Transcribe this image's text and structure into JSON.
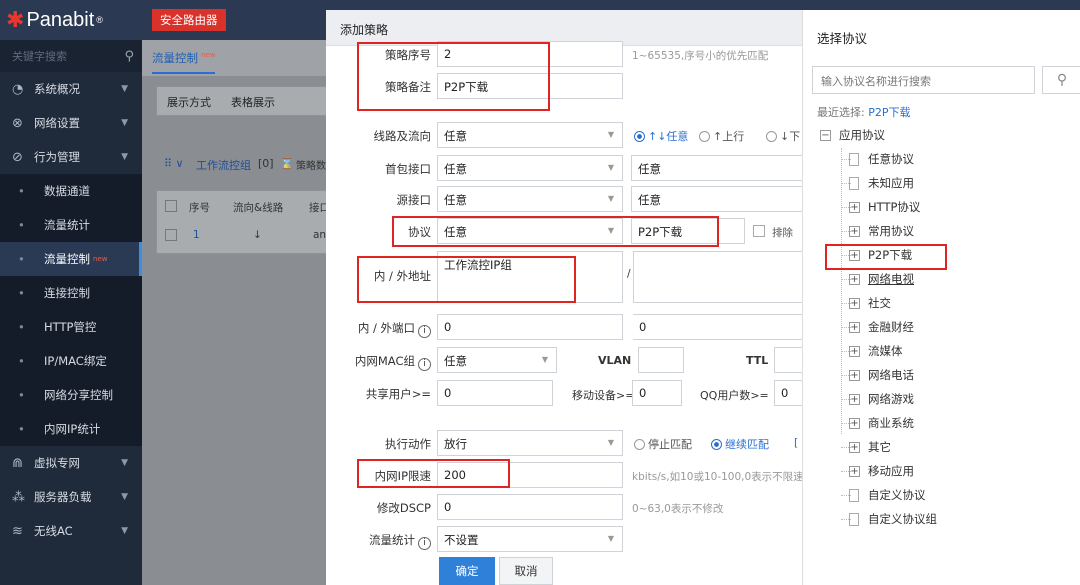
{
  "logo": {
    "name": "Panabit",
    "mark": "®"
  },
  "sidebar": {
    "search_placeholder": "关键字搜索",
    "items": [
      {
        "label": "系统概况",
        "icon": "dashboard-icon",
        "type": "group"
      },
      {
        "label": "网络设置",
        "icon": "network-icon",
        "type": "group"
      },
      {
        "label": "行为管理",
        "icon": "behavior-icon",
        "type": "group"
      },
      {
        "label": "数据通道",
        "type": "sub"
      },
      {
        "label": "流量统计",
        "type": "sub"
      },
      {
        "label": "流量控制",
        "type": "sub",
        "active": true,
        "new": "new"
      },
      {
        "label": "连接控制",
        "type": "sub"
      },
      {
        "label": "HTTP管控",
        "type": "sub"
      },
      {
        "label": "IP/MAC绑定",
        "type": "sub"
      },
      {
        "label": "网络分享控制",
        "type": "sub"
      },
      {
        "label": "内网IP统计",
        "type": "sub"
      },
      {
        "label": "虚拟专网",
        "icon": "vpn-icon",
        "type": "group"
      },
      {
        "label": "服务器负载",
        "icon": "server-icon",
        "type": "group"
      },
      {
        "label": "无线AC",
        "icon": "wifi-icon",
        "type": "group"
      }
    ]
  },
  "topbar": {
    "brand": "安全路由器"
  },
  "background": {
    "tab": "流量控制",
    "tab_new": "new",
    "display_label": "展示方式",
    "display_value": "表格展示",
    "group_label": "工作流控组",
    "group_count": "[0]",
    "group_extra": "策略数",
    "col_seq": "序号",
    "col_dir": "流向&线路",
    "col_if": "接口",
    "row_seq": "1",
    "row_dir": "↓",
    "row_any": "any"
  },
  "modal": {
    "title": "添加策略",
    "seq_label": "策略序号",
    "seq_value": "2",
    "seq_hint": "1~65535,序号小的优先匹配",
    "note_label": "策略备注",
    "note_value": "P2P下载",
    "line_label": "线路及流向",
    "line_value": "任意",
    "dir_any": "↑↓任意",
    "dir_up": "↑上行",
    "dir_down": "↓下",
    "first_if_label": "首包接口",
    "first_if_value": "任意",
    "first_if_value2": "任意",
    "src_if_label": "源接口",
    "src_if_value": "任意",
    "src_if_value2": "任意",
    "proto_label": "协议",
    "proto_value": "任意",
    "proto_value2": "P2P下载",
    "exclude": "排除",
    "addr_label": "内 / 外地址",
    "addr_value": "工作流控IP组",
    "slash": "/",
    "port_label": "内 / 外端口",
    "port_value": "0",
    "port_value2": "0",
    "mac_label": "内网MAC组",
    "mac_value": "任意",
    "vlan_label": "VLAN",
    "ttl_label": "TTL",
    "share_label": "共享用户>=",
    "share_value": "0",
    "mobile_label": "移动设备>=",
    "mobile_value": "0",
    "qq_label": "QQ用户数>=",
    "qq_value": "0",
    "action_label": "执行动作",
    "action_value": "放行",
    "stop_match": "停止匹配",
    "continue_match": "继续匹配",
    "bracket": "[",
    "rate_label": "内网IP限速",
    "rate_value": "200",
    "rate_hint": "kbits/s,如10或10-100,0表示不限速",
    "dscp_label": "修改DSCP",
    "dscp_value": "0",
    "dscp_hint": "0~63,0表示不修改",
    "stat_label": "流量统计",
    "stat_value": "不设置",
    "ok": "确定",
    "cancel": "取消"
  },
  "protocol_panel": {
    "title": "选择协议",
    "search_placeholder": "输入协议名称进行搜索",
    "recent_label": "最近选择:",
    "recent_value": "P2P下载",
    "root": "应用协议",
    "nodes": [
      {
        "label": "任意协议",
        "leaf": true
      },
      {
        "label": "未知应用",
        "leaf": true
      },
      {
        "label": "HTTP协议"
      },
      {
        "label": "常用协议"
      },
      {
        "label": "P2P下载"
      },
      {
        "label": "网络电视",
        "underline": true
      },
      {
        "label": "社交"
      },
      {
        "label": "金融财经"
      },
      {
        "label": "流媒体"
      },
      {
        "label": "网络电话"
      },
      {
        "label": "网络游戏"
      },
      {
        "label": "商业系统"
      },
      {
        "label": "其它"
      },
      {
        "label": "移动应用"
      },
      {
        "label": "自定义协议",
        "leaf": true
      },
      {
        "label": "自定义协议组",
        "leaf": true
      }
    ]
  },
  "colors": {
    "accent": "#2a6fd0",
    "highlight": "#e02424",
    "brand": "#d9322b"
  }
}
